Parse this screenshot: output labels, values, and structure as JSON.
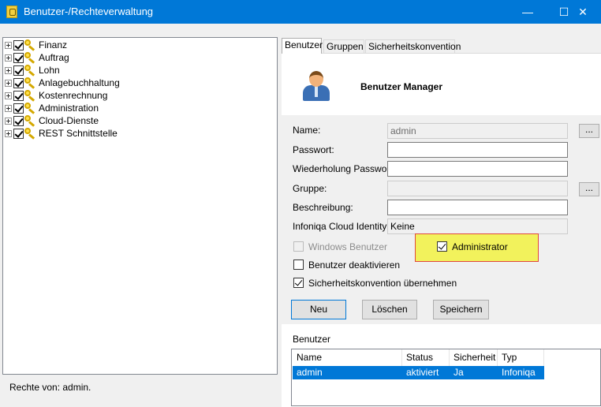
{
  "window": {
    "title": "Benutzer-/Rechteverwaltung",
    "minimize": "—",
    "maximize": "☐",
    "close": "✕"
  },
  "tree": {
    "items": [
      {
        "label": "Finanz"
      },
      {
        "label": "Auftrag"
      },
      {
        "label": "Lohn"
      },
      {
        "label": "Anlagebuchhaltung"
      },
      {
        "label": "Kostenrechnung"
      },
      {
        "label": "Administration"
      },
      {
        "label": "Cloud-Dienste"
      },
      {
        "label": "REST Schnittstelle"
      }
    ]
  },
  "status": "Rechte von: admin.",
  "tabs": [
    "Benutzer",
    "Gruppen",
    "Sicherheitskonvention"
  ],
  "header": {
    "title": "Benutzer Manager"
  },
  "form": {
    "name_label": "Name:",
    "name_value": "admin",
    "password_label": "Passwort:",
    "password_value": "",
    "repeat_password_label": "Wiederholung Passwort:",
    "repeat_password_value": "",
    "group_label": "Gruppe:",
    "group_value": "",
    "description_label": "Beschreibung:",
    "description_value": "",
    "cloud_identity_label": "Infoniqa Cloud Identity:",
    "cloud_identity_value": "Keine",
    "browse_label": "...",
    "windows_user_label": "Windows Benutzer",
    "administrator_label": "Administrator",
    "deactivate_label": "Benutzer deaktivieren",
    "security_convention_label": "Sicherheitskonvention übernehmen"
  },
  "buttons": {
    "new": "Neu",
    "delete": "Löschen",
    "save": "Speichern"
  },
  "users": {
    "label": "Benutzer",
    "columns": [
      "Name",
      "Status",
      "Sicherheit",
      "Typ"
    ],
    "rows": [
      {
        "name": "admin",
        "status": "aktiviert",
        "security": "Ja",
        "type": "Infoniqa"
      }
    ]
  },
  "colors": {
    "titlebar": "#0078d7",
    "selection": "#0078d7",
    "highlight": "#f2f25c",
    "highlight_border": "#e0483c"
  }
}
